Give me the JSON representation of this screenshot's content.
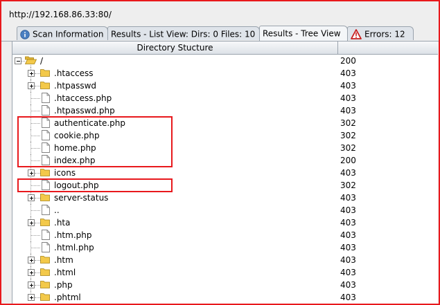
{
  "url": "http://192.168.86.33:80/",
  "tabs": [
    {
      "label": "Scan Information",
      "icon": "info-icon",
      "active": false
    },
    {
      "label": "Results - List View: Dirs: 0 Files: 10",
      "icon": "",
      "active": false
    },
    {
      "label": "Results - Tree View",
      "icon": "",
      "active": true
    },
    {
      "label": "Errors: 12",
      "icon": "warning-icon",
      "active": false
    }
  ],
  "columns": {
    "directory": "Directory Stucture",
    "code": ""
  },
  "tree": [
    {
      "name": "/",
      "code": "200",
      "kind": "root"
    },
    {
      "name": ".htaccess",
      "code": "403",
      "kind": "folder"
    },
    {
      "name": ".htpasswd",
      "code": "403",
      "kind": "folder"
    },
    {
      "name": ".htaccess.php",
      "code": "403",
      "kind": "file"
    },
    {
      "name": ".htpasswd.php",
      "code": "403",
      "kind": "file"
    },
    {
      "name": "authenticate.php",
      "code": "302",
      "kind": "file"
    },
    {
      "name": "cookie.php",
      "code": "302",
      "kind": "file"
    },
    {
      "name": "home.php",
      "code": "302",
      "kind": "file"
    },
    {
      "name": "index.php",
      "code": "200",
      "kind": "file"
    },
    {
      "name": "icons",
      "code": "403",
      "kind": "folder"
    },
    {
      "name": "logout.php",
      "code": "302",
      "kind": "file"
    },
    {
      "name": "server-status",
      "code": "403",
      "kind": "folder"
    },
    {
      "name": "..",
      "code": "403",
      "kind": "file"
    },
    {
      "name": ".hta",
      "code": "403",
      "kind": "folder"
    },
    {
      "name": ".htm.php",
      "code": "403",
      "kind": "file"
    },
    {
      "name": ".html.php",
      "code": "403",
      "kind": "file"
    },
    {
      "name": ".htm",
      "code": "403",
      "kind": "folder"
    },
    {
      "name": ".html",
      "code": "403",
      "kind": "folder"
    },
    {
      "name": ".php",
      "code": "403",
      "kind": "folder"
    },
    {
      "name": ".phtml",
      "code": "403",
      "kind": "folder"
    }
  ],
  "colors": {
    "highlight": "#e8181c",
    "folder": "#f3c94a",
    "info": "#4a7fc1"
  }
}
